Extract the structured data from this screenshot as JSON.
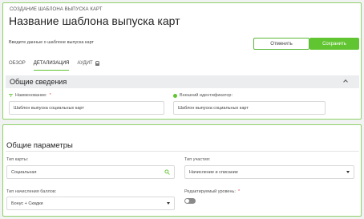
{
  "header": {
    "breadcrumb": "СОЗДАНИЕ ШАБЛОНА ВЫПУСКА КАРТ",
    "title": "Название шаблона выпуска карт",
    "hint": "Введите данные о шаблоне выпуска карт",
    "cancel_label": "Отменить",
    "save_label": "Сохранить"
  },
  "tabs": [
    {
      "label": "ОБЗОР",
      "active": false
    },
    {
      "label": "ДЕТАЛИЗАЦИЯ",
      "active": true
    },
    {
      "label": "АУДИТ",
      "active": false,
      "icon": "lock-icon"
    }
  ],
  "general": {
    "section_title": "Общие сведения",
    "name_label": "Наименование:",
    "name_required": "*",
    "name_value": "Шаблон выпуска социальных карт",
    "ext_id_label": "Внешний идентификатор:",
    "ext_id_value": "Шаблон выпуска социальных карт"
  },
  "params": {
    "section_title": "Общие параметры",
    "card_type_label": "Тип карты:",
    "card_type_value": "Социальная",
    "participation_label": "Тип участия:",
    "participation_value": "Начисление и списание",
    "accrual_label": "Тип начисления баллов:",
    "accrual_value": "Бонус + Скидки",
    "editable_level_label": "Редактируемый уровень:",
    "editable_level_required": "*",
    "editable_level_on": false
  },
  "colors": {
    "accent": "#61c431",
    "card_border": "#8fd16a",
    "required": "#e14b4b"
  }
}
